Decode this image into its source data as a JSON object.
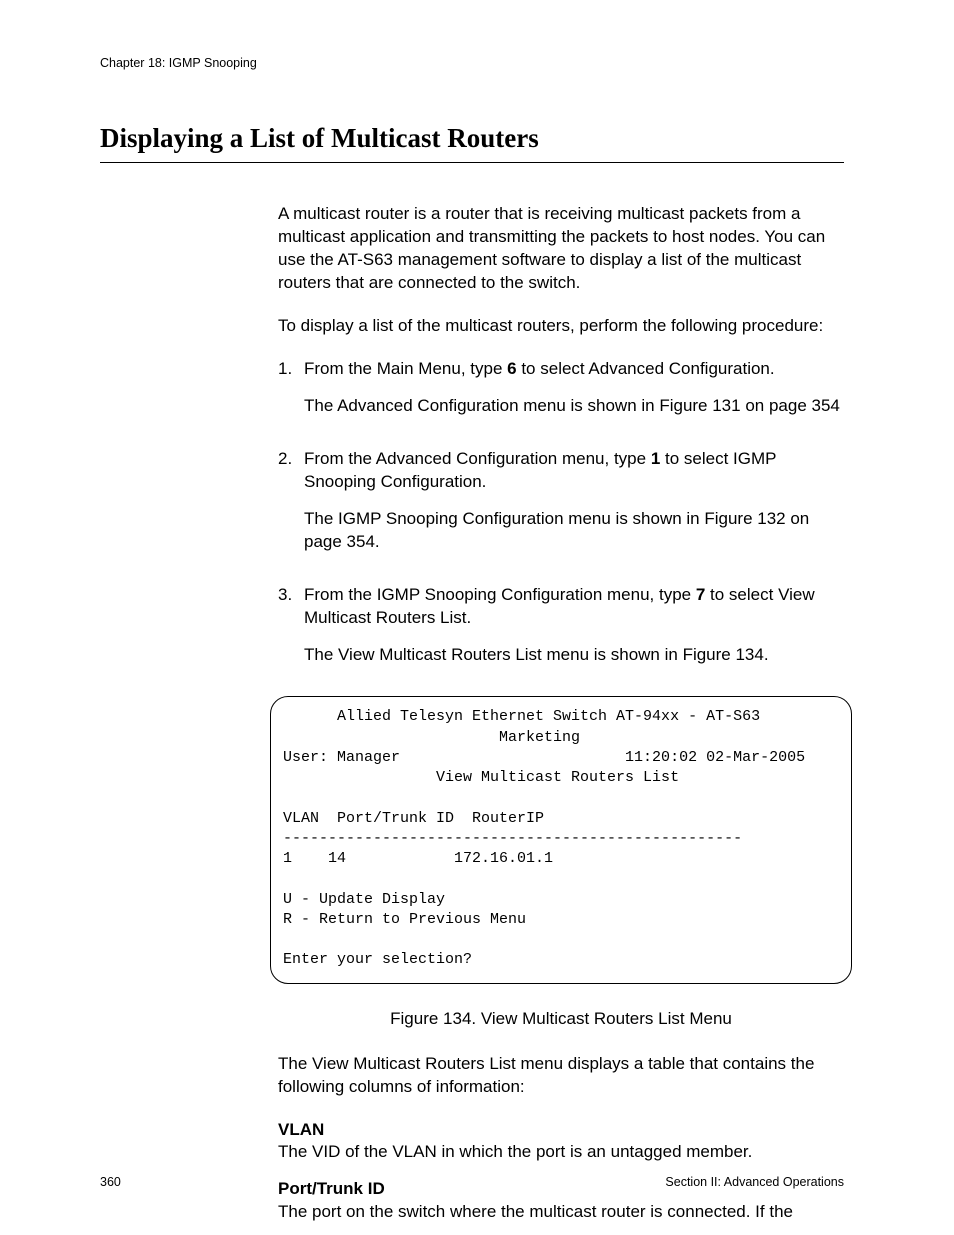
{
  "header": {
    "running": "Chapter 18: IGMP Snooping"
  },
  "title": "Displaying a List of Multicast Routers",
  "intro1": "A multicast router is a router that is receiving multicast packets from a multicast application and transmitting the packets to host nodes. You can use the AT-S63 management software to display a list of the multicast routers that are connected to the switch.",
  "intro2": "To display a list of the multicast routers, perform the following procedure:",
  "steps": {
    "n1": "1.",
    "s1a": "From the Main Menu, type ",
    "s1b": "6",
    "s1c": " to select Advanced Configuration.",
    "s1f": "The Advanced Configuration menu is shown in Figure 131 on page 354",
    "n2": "2.",
    "s2a": "From the Advanced Configuration menu, type ",
    "s2b": "1",
    "s2c": " to select IGMP Snooping Configuration.",
    "s2f": "The IGMP Snooping Configuration menu is shown in Figure 132 on page 354.",
    "n3": "3.",
    "s3a": "From the IGMP Snooping Configuration menu, type ",
    "s3b": "7",
    "s3c": " to select View Multicast Routers List.",
    "s3f": "The View Multicast Routers List menu is shown in Figure 134."
  },
  "terminal": {
    "l01": "      Allied Telesyn Ethernet Switch AT-94xx - AT-S63",
    "l02": "                        Marketing",
    "l03": "User: Manager                         11:20:02 02-Mar-2005",
    "l04": "                 View Multicast Routers List",
    "l05": "",
    "l06": "VLAN  Port/Trunk ID  RouterIP",
    "l07": "---------------------------------------------------",
    "l08": "1    14            172.16.01.1",
    "l09": "",
    "l10": "U - Update Display",
    "l11": "R - Return to Previous Menu",
    "l12": "",
    "l13": "Enter your selection?"
  },
  "caption": "Figure 134. View Multicast Routers List Menu",
  "after1": "The View Multicast Routers List menu displays a table that contains the following columns of information:",
  "defs": {
    "t1": "VLAN",
    "d1": "The VID of the VLAN in which the port is an untagged member.",
    "t2": "Port/Trunk ID",
    "d2": "The port on the switch where the multicast router is connected. If the"
  },
  "footer": {
    "page": "360",
    "section": "Section II: Advanced Operations"
  }
}
